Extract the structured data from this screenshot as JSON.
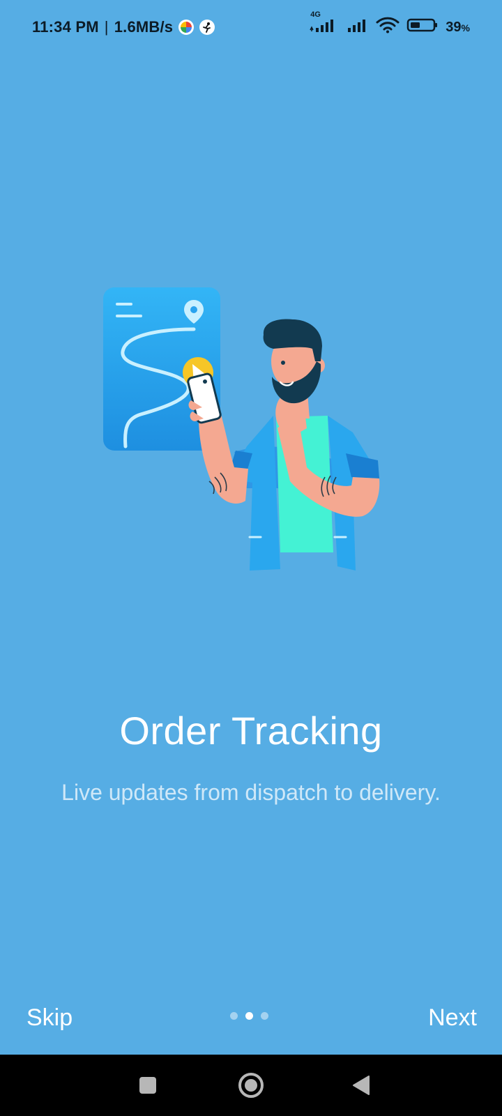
{
  "status_bar": {
    "time": "11:34 PM",
    "separator": "|",
    "speed": "1.6MB/s",
    "network_type": "4G",
    "battery_level": "39",
    "battery_unit": "%",
    "icons": [
      "pinwheel-icon",
      "runner-icon",
      "signal-icon",
      "signal-icon-2",
      "wifi-icon",
      "battery-icon"
    ]
  },
  "onboarding": {
    "title": "Order Tracking",
    "subtitle": "Live updates from dispatch to delivery.",
    "page_index": 2,
    "page_count": 3
  },
  "controls": {
    "skip_label": "Skip",
    "next_label": "Next"
  },
  "colors": {
    "background": "#56ade4",
    "accent_card": "#2196e8",
    "text": "#ffffff"
  },
  "nav_bar": {
    "buttons": [
      "recents-button",
      "home-button",
      "back-button"
    ]
  }
}
